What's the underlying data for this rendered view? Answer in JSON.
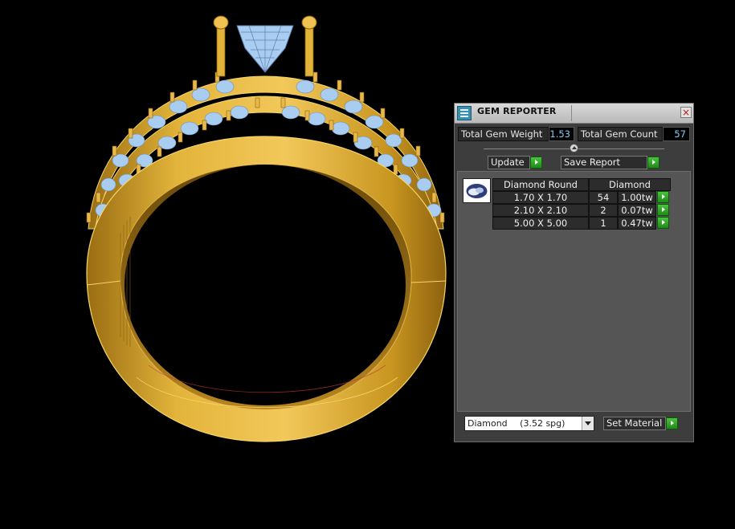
{
  "panel": {
    "title": "GEM REPORTER",
    "close": "×",
    "total_weight_label": "Total Gem Weight",
    "total_weight_value": "1.53",
    "total_count_label": "Total Gem Count",
    "total_count_value": "57",
    "update_label": "Update",
    "save_report_label": "Save Report",
    "table": {
      "header_shape": "Diamond Round",
      "header_material": "Diamond",
      "rows": [
        {
          "size": "1.70 X 1.70",
          "count": "54",
          "weight": "1.00tw"
        },
        {
          "size": "2.10 X 2.10",
          "count": "2",
          "weight": "0.07tw"
        },
        {
          "size": "5.00 X 5.00",
          "count": "1",
          "weight": "0.47tw"
        }
      ]
    },
    "material_select": {
      "name": "Diamond",
      "spg": "(3.52 spg)"
    },
    "set_material_label": "Set Material"
  },
  "colors": {
    "gold": "#e3b43a",
    "gold_dark": "#a97814",
    "gem": "#a9cdf0",
    "panel_bg": "#3d3d3d",
    "accent_green": "#2aa320"
  },
  "icons": {
    "title": "gem-reporter-icon",
    "close": "close-icon",
    "collapse": "collapse-icon",
    "gem": "round-gem-icon",
    "arrow": "green-arrow-icon",
    "dropdown": "chevron-down-icon"
  }
}
